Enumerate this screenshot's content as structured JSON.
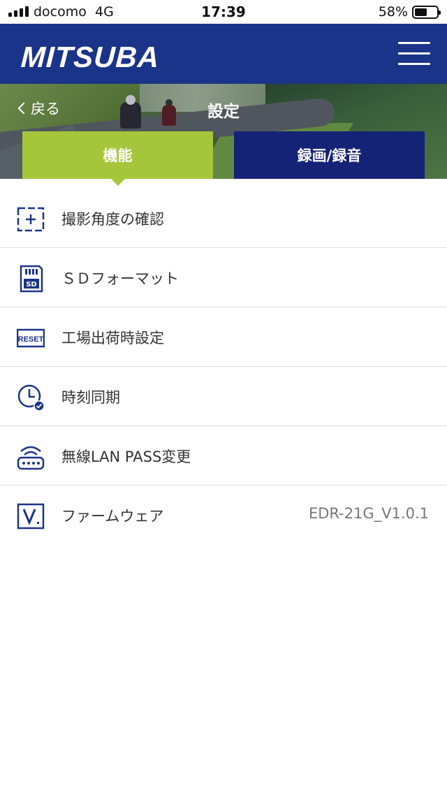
{
  "status_bar": {
    "carrier": "docomo",
    "network": "4G",
    "time": "17:39",
    "battery_percent": "58%",
    "battery_level": 0.58
  },
  "header": {
    "logo": "MITSUBA"
  },
  "nav": {
    "back_label": "戻る",
    "title": "設定"
  },
  "tabs": [
    {
      "label": "機能",
      "active": true
    },
    {
      "label": "録画/録音",
      "active": false
    }
  ],
  "settings": [
    {
      "label": "撮影角度の確認",
      "icon": "camera-angle-icon"
    },
    {
      "label": "ＳＤフォーマット",
      "icon": "sd-card-icon"
    },
    {
      "label": "工場出荷時設定",
      "icon": "reset-icon",
      "icon_text": "RESET"
    },
    {
      "label": "時刻同期",
      "icon": "clock-sync-icon"
    },
    {
      "label": "無線LAN PASS変更",
      "icon": "wifi-router-icon"
    },
    {
      "label": "ファームウェア",
      "icon": "firmware-version-icon",
      "value": "EDR-21G_V1.0.1"
    }
  ],
  "colors": {
    "header_blue": "#1a3489",
    "tab_active_green": "#a5c63b",
    "tab_inactive_navy": "#152377",
    "icon_blue": "#1a3489"
  }
}
